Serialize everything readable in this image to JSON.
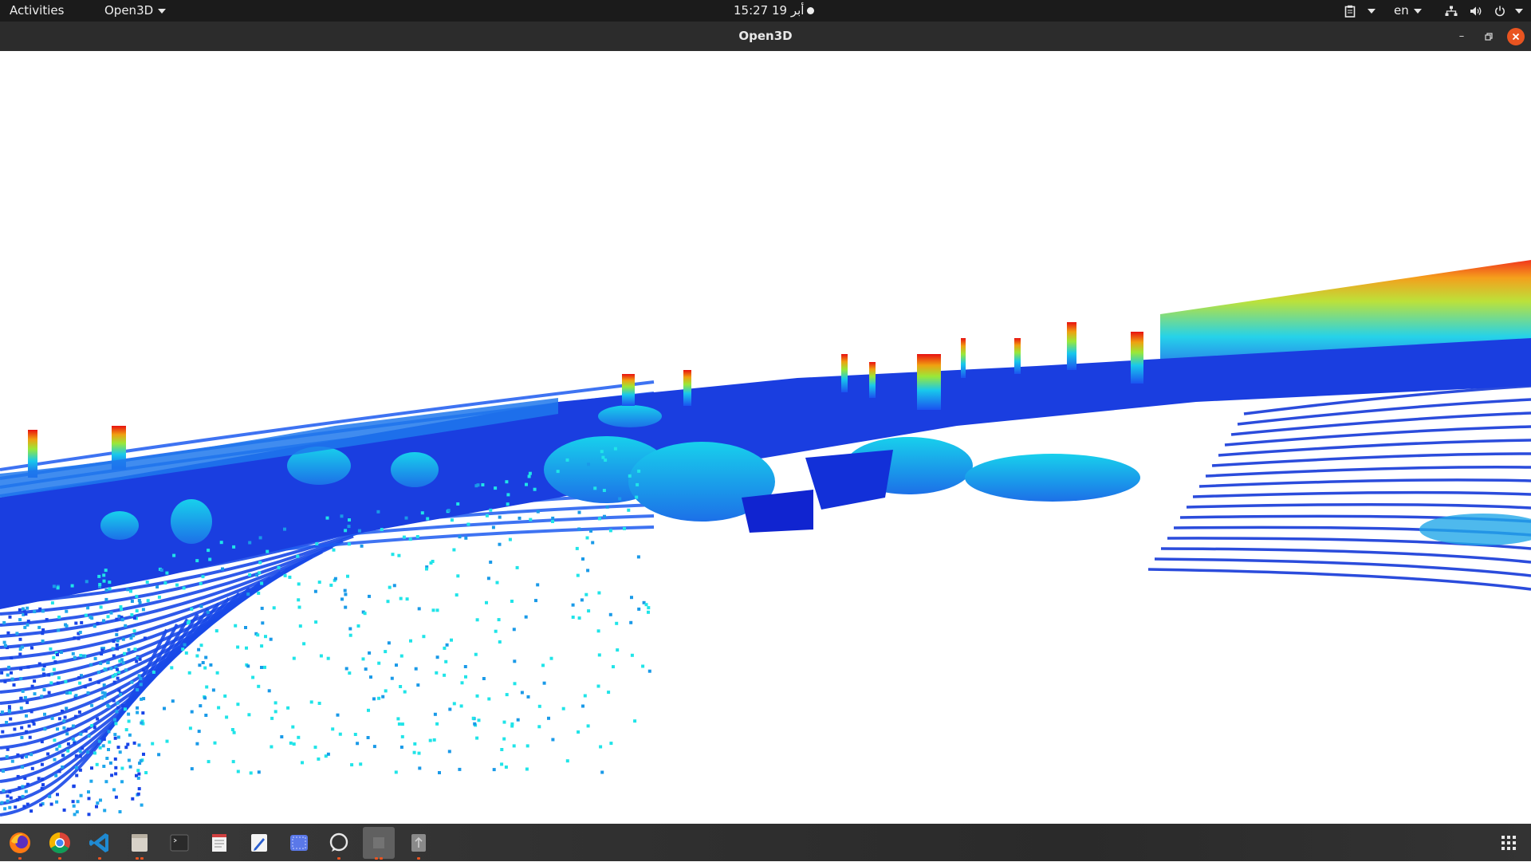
{
  "topbar": {
    "activities": "Activities",
    "app_menu": "Open3D",
    "clock": "15:27  19 أبر",
    "language": "en"
  },
  "window": {
    "title": "Open3D"
  },
  "viewport": {
    "content": "point-cloud"
  },
  "dock": {
    "items": [
      "firefox-icon",
      "chrome-icon",
      "vscode-icon",
      "files-icon",
      "terminal-icon",
      "text-viewer-icon",
      "text-editor-icon",
      "screenshot-icon",
      "chat-icon",
      "open3d-window-icon",
      "usb-drive-icon"
    ],
    "active_item": "open3d-window-icon"
  },
  "colors": {
    "topbar": "#1b1b1b",
    "titlebar": "#2c2c2c",
    "close_button": "#e95420",
    "cloud_low": "#1030d8",
    "cloud_mid": "#18d8e8",
    "cloud_high": "#e81010"
  }
}
